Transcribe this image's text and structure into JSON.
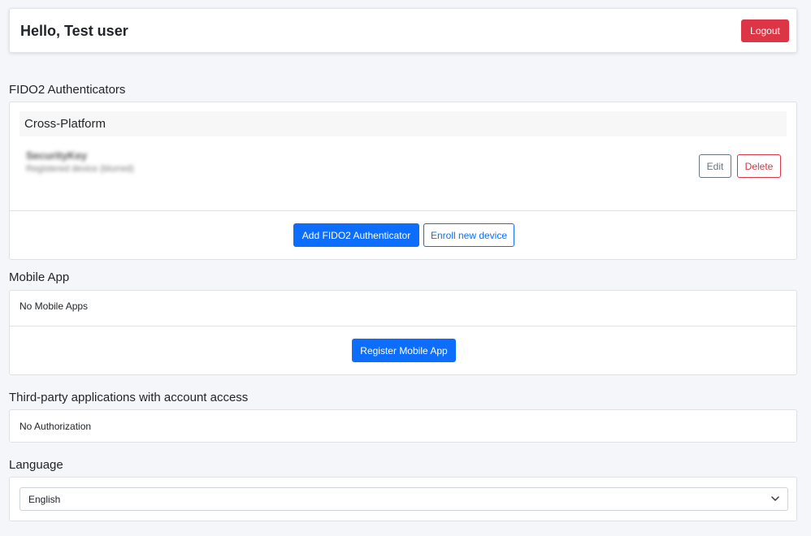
{
  "header": {
    "greeting": "Hello, Test user",
    "logout_label": "Logout"
  },
  "fido2": {
    "section_title": "FIDO2 Authenticators",
    "group_title": "Cross-Platform",
    "authenticator": {
      "name": "SecurityKey",
      "details": "Registered device (blurred)"
    },
    "edit_label": "Edit",
    "delete_label": "Delete",
    "add_label": "Add FIDO2 Authenticator",
    "enroll_label": "Enroll new device"
  },
  "mobile": {
    "section_title": "Mobile App",
    "empty_text": "No Mobile Apps",
    "register_label": "Register Mobile App"
  },
  "third_party": {
    "section_title": "Third-party applications with account access",
    "empty_text": "No Authorization"
  },
  "language": {
    "section_title": "Language",
    "selected": "English"
  },
  "colors": {
    "primary": "#0d6efd",
    "danger": "#dc3545",
    "background": "#f5f6fa"
  }
}
